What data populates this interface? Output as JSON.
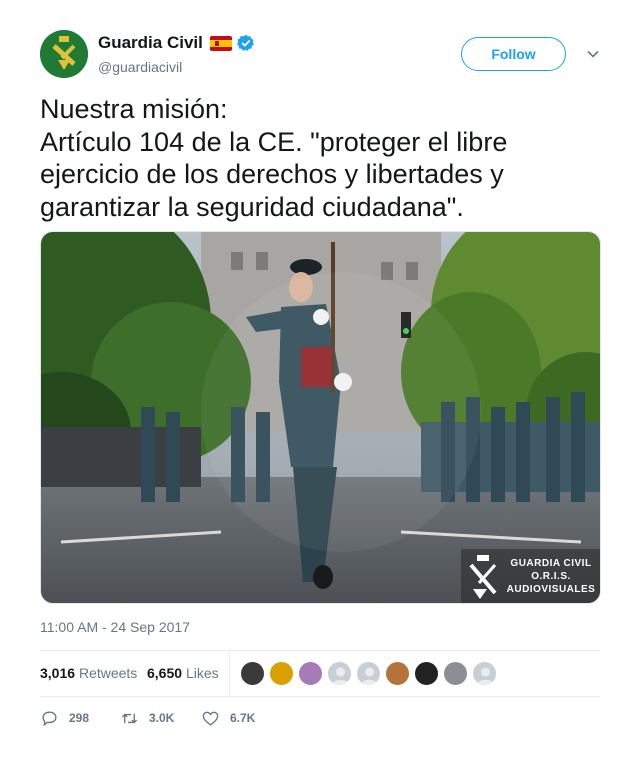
{
  "user": {
    "display_name": "Guardia Civil",
    "handle": "@guardiacivil",
    "verified": true,
    "flag": "spain-flag-icon"
  },
  "follow_label": "Follow",
  "tweet_text": "Nuestra misión:\nArtículo 104 de la CE. \"proteger el libre ejercicio de los derechos y libertades y garantizar la seguridad ciudadana\".",
  "media": {
    "watermark_lines": [
      "GUARDIA CIVIL",
      "O.R.I.S.",
      "AUDIOVISUALES"
    ]
  },
  "timestamp": "11:00 AM - 24 Sep 2017",
  "stats": {
    "retweets_count": "3,016",
    "retweets_label": "Retweets",
    "likes_count": "6,650",
    "likes_label": "Likes"
  },
  "liker_avatars": [
    {
      "color": "#3a3a3a"
    },
    {
      "color": "#d8a000"
    },
    {
      "color": "#a77bb5"
    },
    {
      "color": "#c7cfd6"
    },
    {
      "color": "#c7cfd6"
    },
    {
      "color": "#b5733c"
    },
    {
      "color": "#222222"
    },
    {
      "color": "#8a8f96"
    },
    {
      "color": "#c7cfd6"
    }
  ],
  "actions": {
    "reply_count": "298",
    "retweet_count": "3.0K",
    "like_count": "6.7K"
  },
  "colors": {
    "accent": "#1da1f2",
    "secondary_text": "#657786",
    "brand_green": "#1f7a35"
  }
}
